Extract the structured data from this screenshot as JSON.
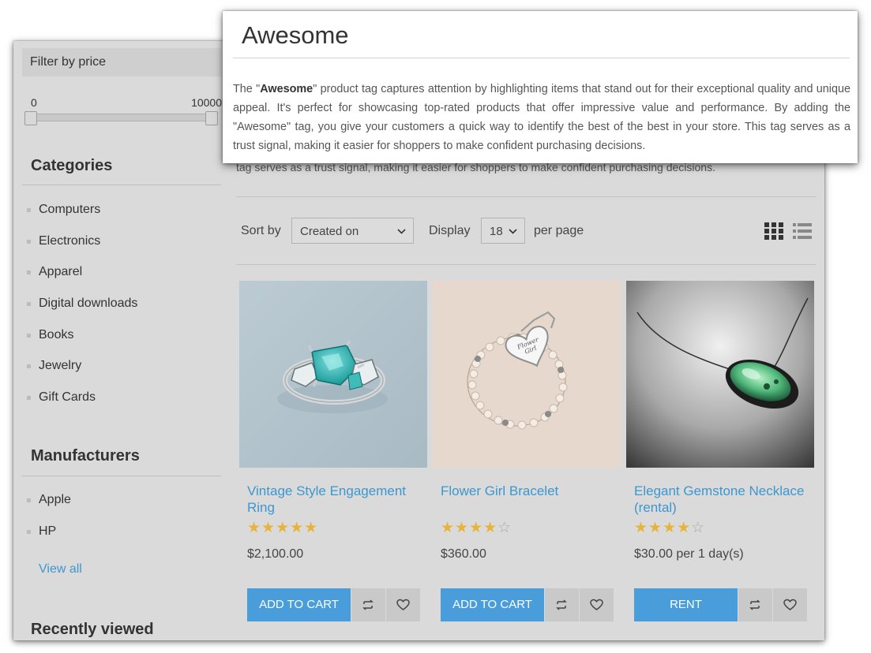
{
  "sidebar": {
    "filter_title": "Filter by price",
    "price_min": "0",
    "price_max": "10000",
    "categories_heading": "Categories",
    "categories": [
      "Computers",
      "Electronics",
      "Apparel",
      "Digital downloads",
      "Books",
      "Jewelry",
      "Gift Cards"
    ],
    "manufacturers_heading": "Manufacturers",
    "manufacturers": [
      "Apple",
      "HP"
    ],
    "view_all": "View all",
    "recently_viewed_heading": "Recently viewed"
  },
  "tag": {
    "title": "Awesome",
    "desc_prefix": "The \"",
    "desc_bold": "Awesome",
    "desc_rest": "\" product tag captures attention by highlighting items that stand out for their exceptional quality and unique appeal. It's perfect for showcasing top-rated products that offer impressive value and performance. By adding the \"Awesome\" tag, you give your customers a quick way to identify the best of the best in your store. This tag serves as a trust signal, making it easier for shoppers to make confident purchasing decisions.",
    "desc_under": "tag serves as a trust signal, making it easier for shoppers to make confident purchasing decisions."
  },
  "toolbar": {
    "sort_label": "Sort by",
    "sort_value": "Created on",
    "display_label": "Display",
    "display_value": "18",
    "per_page_label": "per page",
    "icons": [
      "grid-view-icon",
      "list-view-icon"
    ]
  },
  "products": [
    {
      "title": "Vintage Style Engagement Ring",
      "rating": 5,
      "price": "$2,100.00",
      "button": "ADD TO CART"
    },
    {
      "title": "Flower Girl Bracelet",
      "rating": 4,
      "price": "$360.00",
      "button": "ADD TO CART"
    },
    {
      "title": "Elegant Gemstone Necklace (rental)",
      "rating": 4,
      "price": "$30.00 per 1 day(s)",
      "button": "RENT"
    }
  ],
  "icons": {
    "compare": "compare-icon",
    "wishlist": "heart-icon"
  },
  "colors": {
    "accent": "#4a9ddb",
    "link": "#3c97cf",
    "star": "#e8b33c",
    "page_bg": "#dadada"
  }
}
